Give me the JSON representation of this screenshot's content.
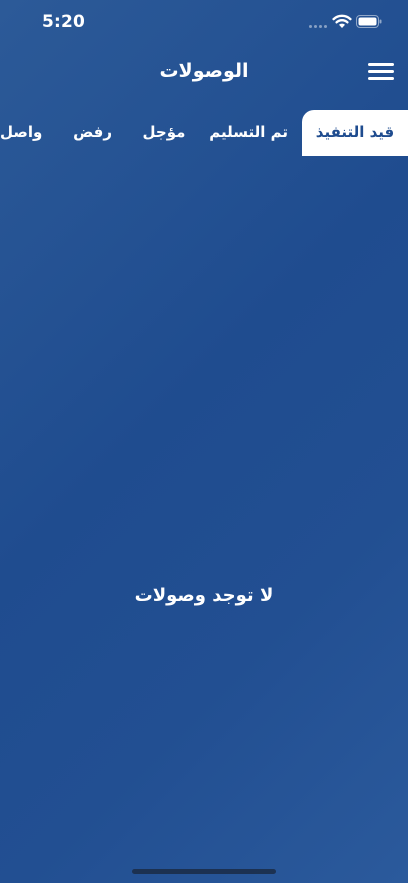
{
  "status": {
    "time": "5:20"
  },
  "header": {
    "title": "الوصولات"
  },
  "tabs": [
    {
      "label": "قيد التنفيذ"
    },
    {
      "label": "تم التسليم"
    },
    {
      "label": "مؤجل"
    },
    {
      "label": "رفض"
    },
    {
      "label": "واصل ج"
    }
  ],
  "main": {
    "empty_message": "لا توجد وصولات"
  },
  "colors": {
    "primary": "#1f4c8f",
    "tab_active_bg": "#ffffff",
    "text": "#ffffff"
  }
}
